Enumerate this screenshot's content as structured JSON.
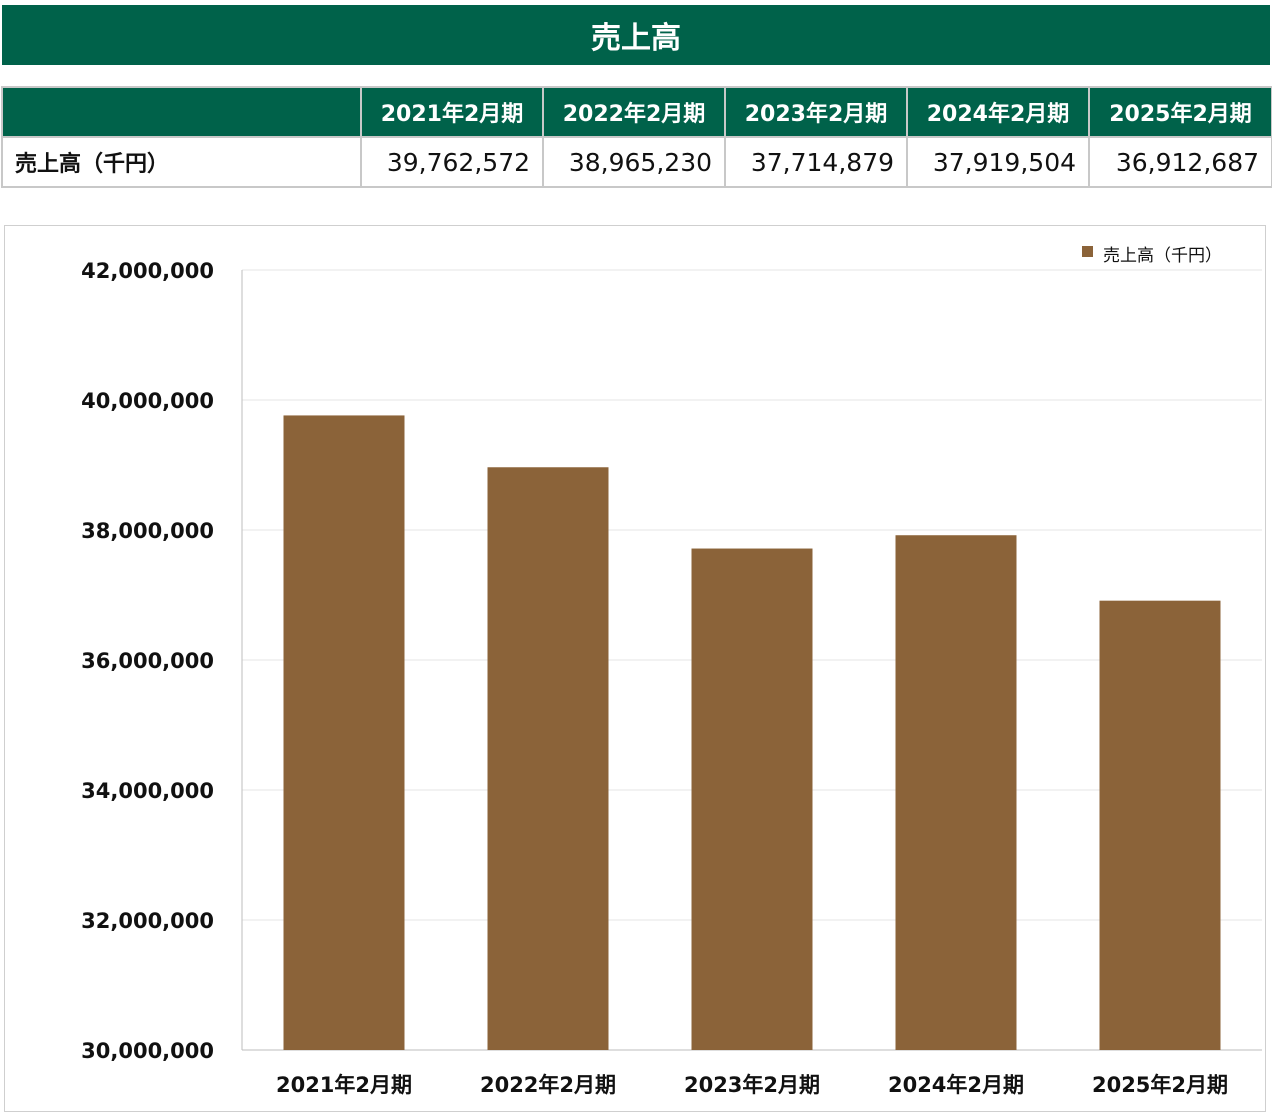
{
  "title": "売上高",
  "table": {
    "headers": [
      "",
      "2021年2月期",
      "2022年2月期",
      "2023年2月期",
      "2024年2月期",
      "2025年2月期"
    ],
    "row_label": "売上高（千円）",
    "values": [
      "39,762,572",
      "38,965,230",
      "37,714,879",
      "37,919,504",
      "36,912,687"
    ]
  },
  "chart_data": {
    "type": "bar",
    "categories": [
      "2021年2月期",
      "2022年2月期",
      "2023年2月期",
      "2024年2月期",
      "2025年2月期"
    ],
    "series": [
      {
        "name": "売上高（千円）",
        "values": [
          39762572,
          38965230,
          37714879,
          37919504,
          36912687
        ],
        "color": "#8b6339"
      }
    ],
    "ylim": [
      30000000,
      42000000
    ],
    "yticks": [
      30000000,
      32000000,
      34000000,
      36000000,
      38000000,
      40000000,
      42000000
    ],
    "ytick_labels": [
      "30,000,000",
      "32,000,000",
      "34,000,000",
      "36,000,000",
      "38,000,000",
      "40,000,000",
      "42,000,000"
    ],
    "grid": true,
    "legend_position": "top-right",
    "colors": {
      "header_bg": "#00624a",
      "bar": "#8b6339",
      "grid": "#e6e6e6"
    }
  }
}
